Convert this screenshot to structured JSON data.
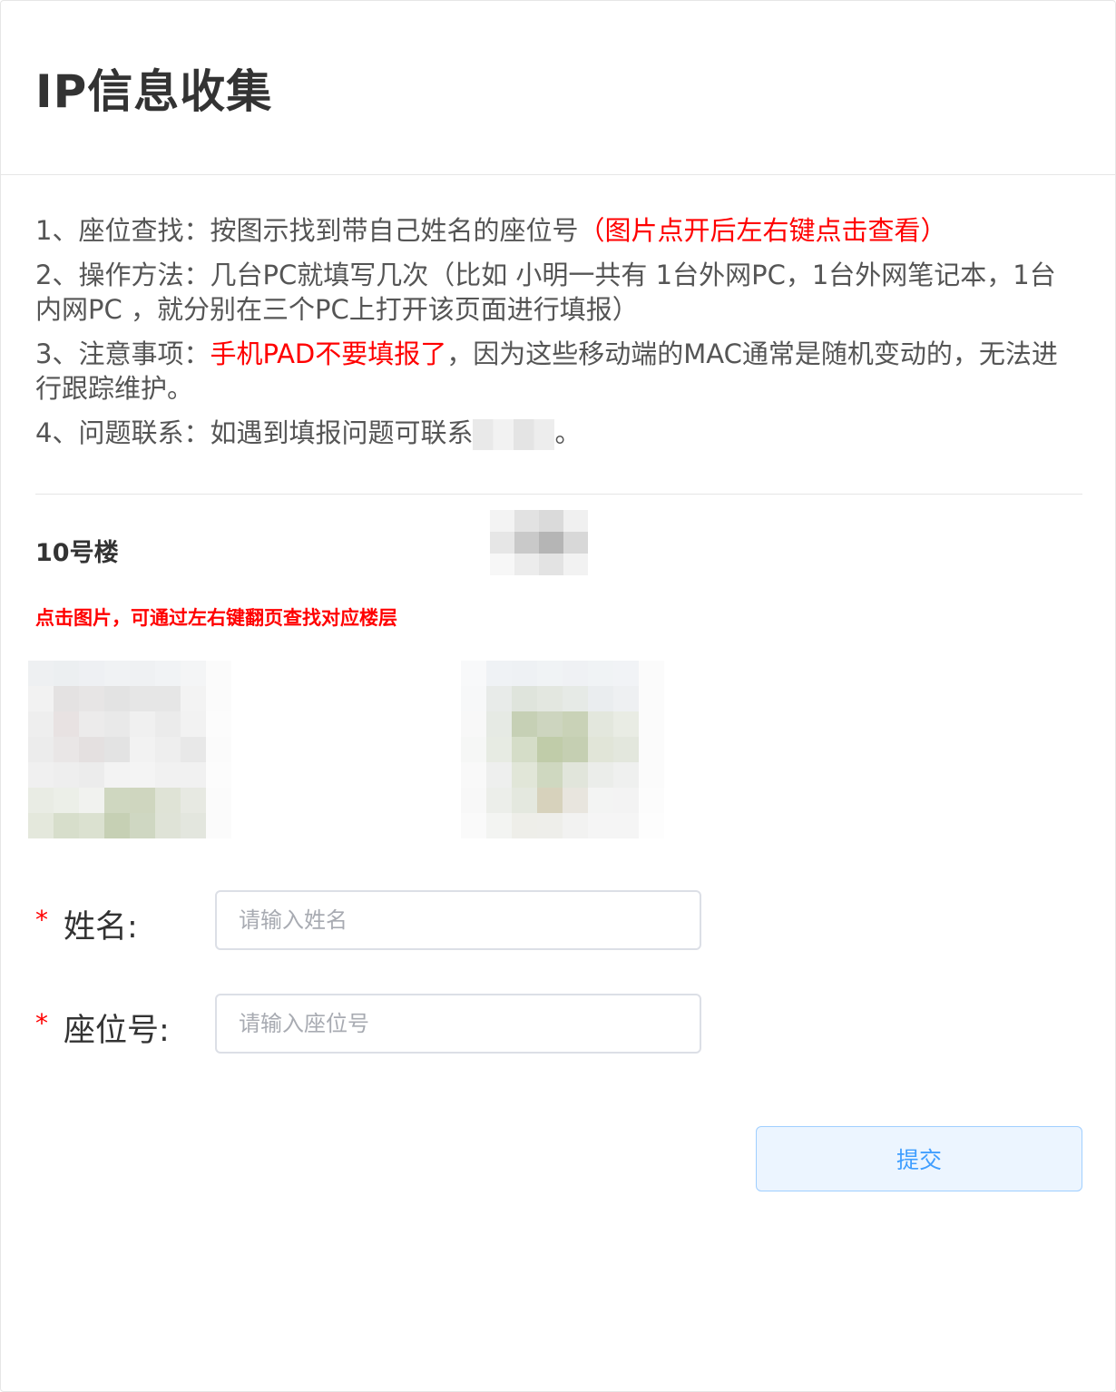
{
  "page": {
    "title": "IP信息收集"
  },
  "instructions": {
    "line1_prefix": "1、座位查找：按图示找到带自己姓名的座位号",
    "line1_red": "（图片点开后左右键点击查看）",
    "line2": "2、操作方法：几台PC就填写几次（比如 小明一共有 1台外网PC，1台外网笔记本，1台内网PC ，就分别在三个PC上打开该页面进行填报）",
    "line3_prefix": "3、注意事项：",
    "line3_red": "手机PAD不要填报了",
    "line3_suffix": "，因为这些移动端的MAC通常是随机变动的，无法进行跟踪维护。",
    "line4_prefix": "4、问题联系：如遇到填报问题可联系",
    "line4_suffix": "。"
  },
  "section": {
    "building": "10号楼",
    "hint": "点击图片，可通过左右键翻页查找对应楼层"
  },
  "form": {
    "name_label": "姓名:",
    "name_placeholder": "请输入姓名",
    "seat_label": "座位号:",
    "seat_placeholder": "请输入座位号",
    "required_mark": "*",
    "submit_label": "提交"
  },
  "colors": {
    "accent_red": "#ff0000",
    "button_text": "#409eff",
    "button_bg": "#ecf5ff",
    "button_border": "#a0cfff"
  }
}
